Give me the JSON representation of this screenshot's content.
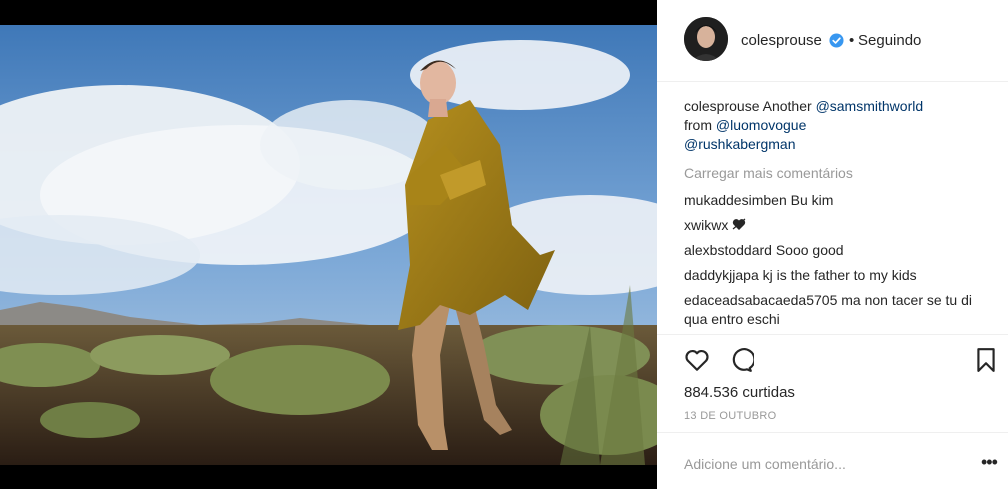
{
  "post": {
    "username": "colesprouse",
    "follow_separator": "•",
    "follow_status": "Seguindo",
    "caption_username": "colesprouse",
    "caption_text": "Another",
    "caption_mentions": [
      "@samsmithworld",
      "@luomovogue",
      "@rushkabergman"
    ],
    "caption_from": "from",
    "load_more": "Carregar mais comentários",
    "comments": [
      {
        "user": "mukaddesimben",
        "text": "Bu kim"
      },
      {
        "user": "xwikwx",
        "text": ""
      },
      {
        "user": "alexbstoddard",
        "text": "Sooo good"
      },
      {
        "user": "daddykjjapa",
        "text": "kj is the father to my kids"
      },
      {
        "user": "edaceadsabacaeda5705",
        "text": "ma non tacer se tu di qua entro eschi"
      }
    ],
    "likes": "884.536 curtidas",
    "date": "13 DE OUTUBRO",
    "add_comment_placeholder": "Adicione um comentário...",
    "more_options": "•••"
  },
  "colors": {
    "accent_link": "#003569",
    "verified": "#3897f0",
    "muted": "#999999"
  },
  "icons": [
    "verified-badge-icon",
    "heart-icon",
    "comment-icon",
    "bookmark-icon",
    "more-options-icon",
    "heart-emoji-icon"
  ]
}
